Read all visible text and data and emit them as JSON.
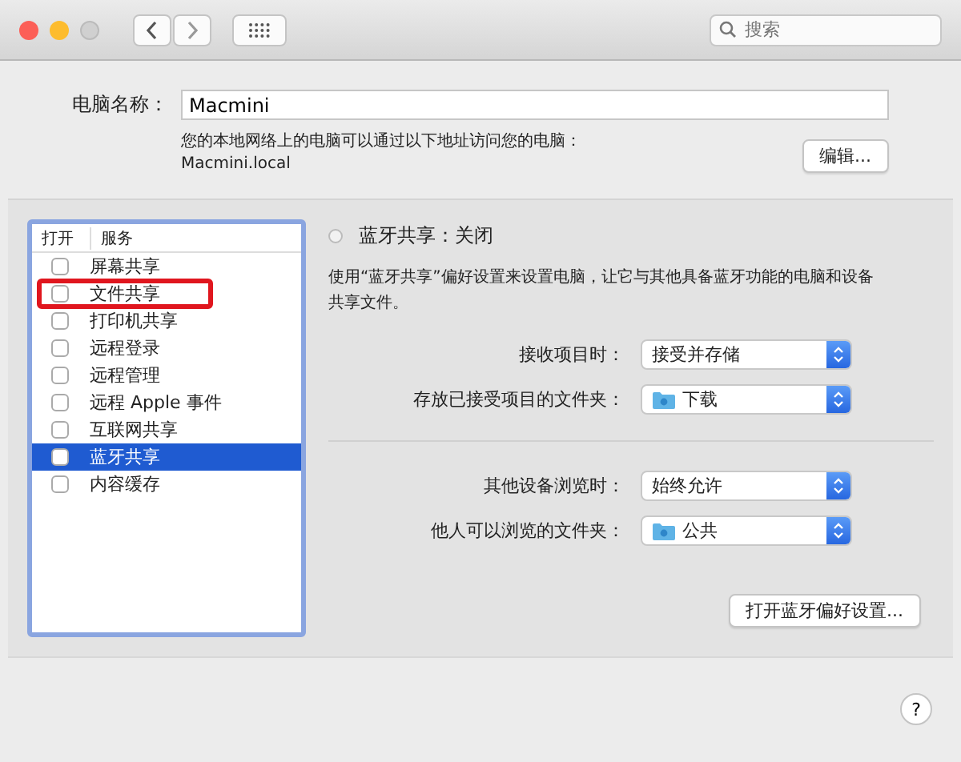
{
  "toolbar": {
    "search": {
      "placeholder": "搜索"
    }
  },
  "computer_name": {
    "label": "电脑名称：",
    "value": "Macmini",
    "note": "您的本地网络上的电脑可以通过以下地址访问您的电脑：",
    "address": "Macmini.local",
    "edit_button": "编辑..."
  },
  "services": {
    "columns": [
      "打开",
      "服务"
    ],
    "rows": [
      {
        "name": "屏幕共享",
        "checked": false,
        "selected": false,
        "marked": false
      },
      {
        "name": "文件共享",
        "checked": false,
        "selected": false,
        "marked": true
      },
      {
        "name": "打印机共享",
        "checked": false,
        "selected": false,
        "marked": false
      },
      {
        "name": "远程登录",
        "checked": false,
        "selected": false,
        "marked": false
      },
      {
        "name": "远程管理",
        "checked": false,
        "selected": false,
        "marked": false
      },
      {
        "name": "远程 Apple 事件",
        "checked": false,
        "selected": false,
        "marked": false
      },
      {
        "name": "互联网共享",
        "checked": false,
        "selected": false,
        "marked": false
      },
      {
        "name": "蓝牙共享",
        "checked": false,
        "selected": true,
        "marked": false
      },
      {
        "name": "内容缓存",
        "checked": false,
        "selected": false,
        "marked": false
      }
    ]
  },
  "detail": {
    "status": "蓝牙共享：关闭",
    "on": false,
    "description": "使用“蓝牙共享”偏好设置来设置电脑，让它与其他具备蓝牙功能的电脑和设备共享文件。",
    "groups": [
      [
        {
          "label": "接收项目时：",
          "value": "接受并存储",
          "kind": "plain"
        },
        {
          "label": "存放已接受项目的文件夹：",
          "value": "下载",
          "kind": "folder"
        }
      ],
      [
        {
          "label": "其他设备浏览时：",
          "value": "始终允许",
          "kind": "plain"
        },
        {
          "label": "他人可以浏览的文件夹：",
          "value": "公共",
          "kind": "folder"
        }
      ]
    ],
    "button": "打开蓝牙偏好设置..."
  },
  "help": "?"
}
